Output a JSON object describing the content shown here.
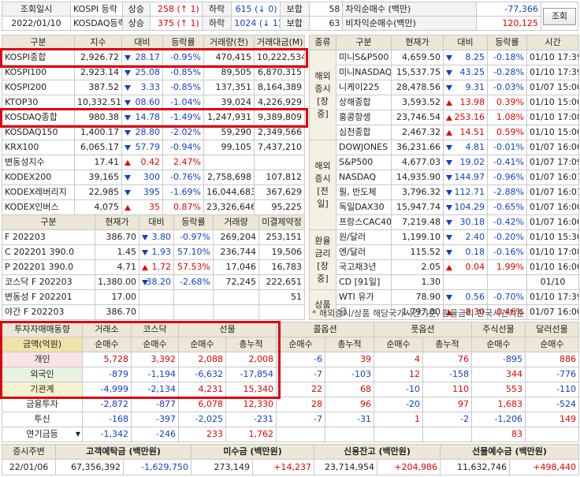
{
  "top": {
    "label1": "조회일시",
    "date": "2022/01/10",
    "kospi": {
      "name": "KOSPI 등락",
      "rise_label": "상승",
      "rise": "258",
      "up_arrow": "↑",
      "up_count": "1",
      "fall_label": "하락",
      "fall": "615",
      "down_arrow": "↓",
      "down_count": "0",
      "flat_label": "보합",
      "flat": "58"
    },
    "kosdaq": {
      "name": "KOSDAQ등락",
      "rise_label": "상승",
      "rise": "375",
      "up_arrow": "↑",
      "up_count": "1",
      "fall_label": "하락",
      "fall": "1024",
      "down_arrow": "↓",
      "down_count": "1",
      "flat_label": "보합",
      "flat": "63"
    },
    "arb1_label": "차익순매수 (백만)",
    "arb1": "-77,366",
    "arb2_label": "비차익순매수(백만)",
    "arb2": "120,125",
    "query_button": "조회"
  },
  "index": {
    "headers": [
      "구분",
      "지수",
      "대비",
      "등락률",
      "거래량(천)",
      "거래대금(M)"
    ],
    "rows": [
      {
        "name": "KOSPI종합",
        "value": "2,926.72",
        "dir": "down",
        "diff": "28.17",
        "rate": "-0.95%",
        "vol": "470,415",
        "amt": "10,222,534"
      },
      {
        "name": "KOSPI100",
        "value": "2,923.14",
        "dir": "down",
        "diff": "25.08",
        "rate": "-0.85%",
        "vol": "89,505",
        "amt": "6,870,315"
      },
      {
        "name": "KOSPI200",
        "value": "387.52",
        "dir": "down",
        "diff": "3.33",
        "rate": "-0.85%",
        "vol": "137,351",
        "amt": "8,164,389"
      },
      {
        "name": "KTOP30",
        "value": "10,332.51",
        "dir": "down",
        "diff": "08.60",
        "rate": "-1.04%",
        "vol": "39,024",
        "amt": "4,226,929"
      },
      {
        "name": "KOSDAQ종합",
        "value": "980.38",
        "dir": "down",
        "diff": "14.78",
        "rate": "-1.49%",
        "vol": "1,247,931",
        "amt": "9,389,809"
      },
      {
        "name": "KOSDAQ150",
        "value": "1,400.17",
        "dir": "down",
        "diff": "28.80",
        "rate": "-2.02%",
        "vol": "59,290",
        "amt": "2,349,566"
      },
      {
        "name": "KRX100",
        "value": "6,065.17",
        "dir": "down",
        "diff": "57.79",
        "rate": "-0.94%",
        "vol": "99,105",
        "amt": "7,437,210"
      },
      {
        "name": "변동성지수",
        "value": "17.41",
        "dir": "up",
        "diff": "0.42",
        "rate": "2.47%",
        "vol": "",
        "amt": ""
      },
      {
        "name": "KODEX200",
        "value": "39,165",
        "dir": "down",
        "diff": "300",
        "rate": "-0.76%",
        "vol": "2,758,698",
        "amt": "107,812"
      },
      {
        "name": "KODEX레버리지",
        "value": "22,985",
        "dir": "down",
        "diff": "395",
        "rate": "-1.69%",
        "vol": "16,044,683",
        "amt": "367,629"
      },
      {
        "name": "KODEX인버스",
        "value": "4,075",
        "dir": "up",
        "diff": "35",
        "rate": "0.87%",
        "vol": "23,326,646",
        "amt": "95,225"
      }
    ]
  },
  "futures": {
    "headers": [
      "구분",
      "현재가",
      "대비",
      "등락률",
      "거래량",
      "미결제약정"
    ],
    "rows": [
      {
        "name": "F 202203",
        "value": "386.70",
        "dir": "down",
        "diff": "3.80",
        "rate": "-0.97%",
        "vol": "269,204",
        "oi": "253,151"
      },
      {
        "name": "C 202201 390.0",
        "value": "1.45",
        "dir": "down",
        "diff": "1.93",
        "rate": "57.10%",
        "vol": "236,744",
        "oi": "19,506"
      },
      {
        "name": "P 202201 390.0",
        "value": "4.71",
        "dir": "up",
        "diff": "1.72",
        "rate": "57.53%",
        "vol": "17,046",
        "oi": "16,783"
      },
      {
        "name": "코스닥 F 202203",
        "value": "1,380.00",
        "dir": "down",
        "diff": "38.20",
        "rate": "-2.68%",
        "vol": "72,245",
        "oi": "222,651"
      },
      {
        "name": "변동성 F 202201",
        "value": "17.00",
        "dir": "",
        "diff": "",
        "rate": "",
        "vol": "",
        "oi": "51"
      },
      {
        "name": "야간 F 202203",
        "value": "386.70",
        "dir": "",
        "diff": "",
        "rate": "",
        "vol": "",
        "oi": ""
      }
    ]
  },
  "world": {
    "headers": [
      "종류",
      "구분",
      "현재가",
      "대비",
      "등락률",
      "시간"
    ],
    "groups": [
      {
        "label": "해외\n증시\n[장중]",
        "rows": [
          {
            "name": "미니S&P500",
            "value": "4,659.50",
            "dir": "down",
            "diff": "8.25",
            "rate": "-0.18%",
            "time": "01/10 17:39"
          },
          {
            "name": "미니NASDAQ",
            "value": "15,537.75",
            "dir": "down",
            "diff": "43.25",
            "rate": "-0.28%",
            "time": "01/10 17:39"
          },
          {
            "name": "니케이225",
            "value": "28,478.56",
            "dir": "down",
            "diff": "9.31",
            "rate": "-0.03%",
            "time": "01/07 15:00"
          },
          {
            "name": "상해종합",
            "value": "3,593.52",
            "dir": "up",
            "diff": "13.98",
            "rate": "0.39%",
            "time": "01/10 15:00"
          },
          {
            "name": "홍콩항셍",
            "value": "23,746.54",
            "dir": "up",
            "diff": "253.16",
            "rate": "1.08%",
            "time": "01/10 17:08"
          },
          {
            "name": "심천종합",
            "value": "2,467.32",
            "dir": "up",
            "diff": "14.51",
            "rate": "0.59%",
            "time": "01/10 15:00"
          }
        ]
      },
      {
        "label": "해외\n증시\n[전일]",
        "rows": [
          {
            "name": "DOWJONES",
            "value": "36,231.66",
            "dir": "down",
            "diff": "4.81",
            "rate": "-0.01%",
            "time": "01/07 16:00"
          },
          {
            "name": "S&P500",
            "value": "4,677.03",
            "dir": "down",
            "diff": "19.02",
            "rate": "-0.41%",
            "time": "01/07 17:09"
          },
          {
            "name": "NASDAQ",
            "value": "14,935.90",
            "dir": "down",
            "diff": "144.97",
            "rate": "-0.96%",
            "time": "01/07 16:01"
          },
          {
            "name": "필, 반도체",
            "value": "3,796.32",
            "dir": "down",
            "diff": "112.71",
            "rate": "-2.88%",
            "time": "01/07 16:01"
          },
          {
            "name": "독일DAX30",
            "value": "15,947.74",
            "dir": "down",
            "diff": "104.29",
            "rate": "-0.65%",
            "time": "01/07 16:00"
          },
          {
            "name": "프랑스CAC40",
            "value": "7,219.48",
            "dir": "down",
            "diff": "30.18",
            "rate": "-0.42%",
            "time": "01/07 16:00"
          }
        ]
      },
      {
        "label": "환율\n금리\n[장중]",
        "rows": [
          {
            "name": "원/달러",
            "value": "1,199.10",
            "dir": "down",
            "diff": "2.40",
            "rate": "-0.20%",
            "time": "01/10 15:30"
          },
          {
            "name": "엔/달러",
            "value": "115.52",
            "dir": "down",
            "diff": "0.18",
            "rate": "-0.16%",
            "time": "01/10 17:08"
          },
          {
            "name": "국고채3년",
            "value": "2.05",
            "dir": "up",
            "diff": "0.04",
            "rate": "1.99%",
            "time": "01/10 16:00"
          },
          {
            "name": "CD [91일]",
            "value": "1.30",
            "dir": "",
            "diff": "",
            "rate": "",
            "time": "01/10"
          }
        ]
      },
      {
        "label": "상품",
        "rows": [
          {
            "name": "WTI 유가",
            "value": "78.90",
            "dir": "down",
            "diff": "0.56",
            "rate": "-0.70%",
            "time": "01/10 17:39"
          },
          {
            "name": "금",
            "value": "1,797.00",
            "dir": "up",
            "diff": "8.30",
            "rate": "0.46%",
            "time": "01/07 16:00"
          }
        ]
      }
    ],
    "note": "* 해외증시/상품 해당국가시간기준, 환율금리 한국시간기준"
  },
  "investor": {
    "h1": [
      "투자자매매동향",
      "거래소",
      "코스닥",
      "선물",
      "콜옵션",
      "풋옵션",
      "주식선물",
      "달러선물"
    ],
    "h2": [
      "금액(억원)",
      "순매수",
      "순매수",
      "순매수",
      "총누적",
      "순매수",
      "총누적",
      "순매수",
      "총누적",
      "순매수",
      "순매수"
    ],
    "rows": [
      {
        "name": "개인",
        "v": [
          "5,728",
          "3,392",
          "2,088",
          "2,008",
          "-6",
          "39",
          "4",
          "76",
          "-895",
          "886"
        ]
      },
      {
        "name": "외국인",
        "v": [
          "-879",
          "-1,194",
          "-6,632",
          "-17,854",
          "-7",
          "-103",
          "12",
          "-158",
          "344",
          "-776"
        ]
      },
      {
        "name": "기관계",
        "v": [
          "-4,999",
          "-2,134",
          "4,231",
          "15,340",
          "22",
          "68",
          "-10",
          "110",
          "553",
          "-110"
        ]
      },
      {
        "name": "금융투자",
        "v": [
          "-2,872",
          "-877",
          "6,078",
          "12,330",
          "28",
          "96",
          "-20",
          "97",
          "1,683",
          "-524"
        ]
      },
      {
        "name": "투신",
        "v": [
          "-168",
          "-397",
          "-2,025",
          "-231",
          "-7",
          "-31",
          "1",
          "-2",
          "-1,206",
          "149"
        ]
      },
      {
        "name": "연기금등",
        "v": [
          "-1,342",
          "-246",
          "233",
          "1,762",
          "",
          "",
          "",
          "",
          "83",
          ""
        ]
      }
    ]
  },
  "footer": {
    "headers": [
      "증시주변",
      "고객예탁금 (백만원)",
      "미수금 (백만원)",
      "신용잔고 (백만원)",
      "선물예수금 (백만원)"
    ],
    "date": "22/01/06",
    "deposit": "67,356,392",
    "deposit_chg": "-1,629,750",
    "unpaid": "273,149",
    "unpaid_chg": "+14,237",
    "credit": "23,714,954",
    "credit_chg": "+204,986",
    "fut": "11,632,746",
    "fut_chg": "+498,440"
  },
  "colors": {
    "up": "#e60000",
    "down": "#1340c8",
    "highlight": "#e00010",
    "header": "#ece7d6"
  }
}
